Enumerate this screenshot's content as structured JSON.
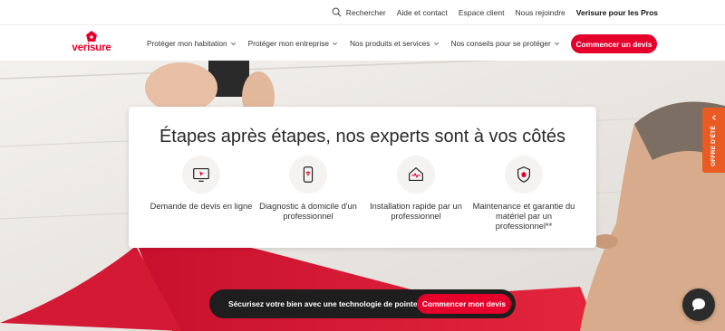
{
  "utility": {
    "search_label": "Rechercher",
    "help_label": "Aide et contact",
    "client_label": "Espace client",
    "join_label": "Nous rejoindre",
    "pros_label": "Verisure pour les Pros"
  },
  "brand": {
    "name": "verisure",
    "color": "#e4002b"
  },
  "nav": {
    "items": [
      {
        "label": "Protéger mon habitation"
      },
      {
        "label": "Protéger mon entreprise"
      },
      {
        "label": "Nos produits et services"
      },
      {
        "label": "Nos conseils pour se protéger"
      }
    ],
    "cta_label": "Commencer un devis"
  },
  "steps": {
    "title": "Étapes après étapes, nos experts sont à vos côtés",
    "items": [
      {
        "label": "Demande de devis en ligne",
        "icon": "monitor-cursor-icon"
      },
      {
        "label": "Diagnostic à domicile d'un professionnel",
        "icon": "phone-wifi-icon"
      },
      {
        "label": "Installation rapide par un professionnel",
        "icon": "house-pulse-icon"
      },
      {
        "label": "Maintenance et garantie du matériel par un professionnel**",
        "icon": "shield-house-icon"
      }
    ]
  },
  "bottom_bar": {
    "text": "Sécurisez votre bien avec une technologie de pointe",
    "button_label": "Commencer mon devis"
  },
  "side_tab": {
    "label": "OFFRE D'ÉTÉ",
    "color": "#e95b23"
  },
  "chat": {
    "icon": "chat-bubble-icon"
  }
}
